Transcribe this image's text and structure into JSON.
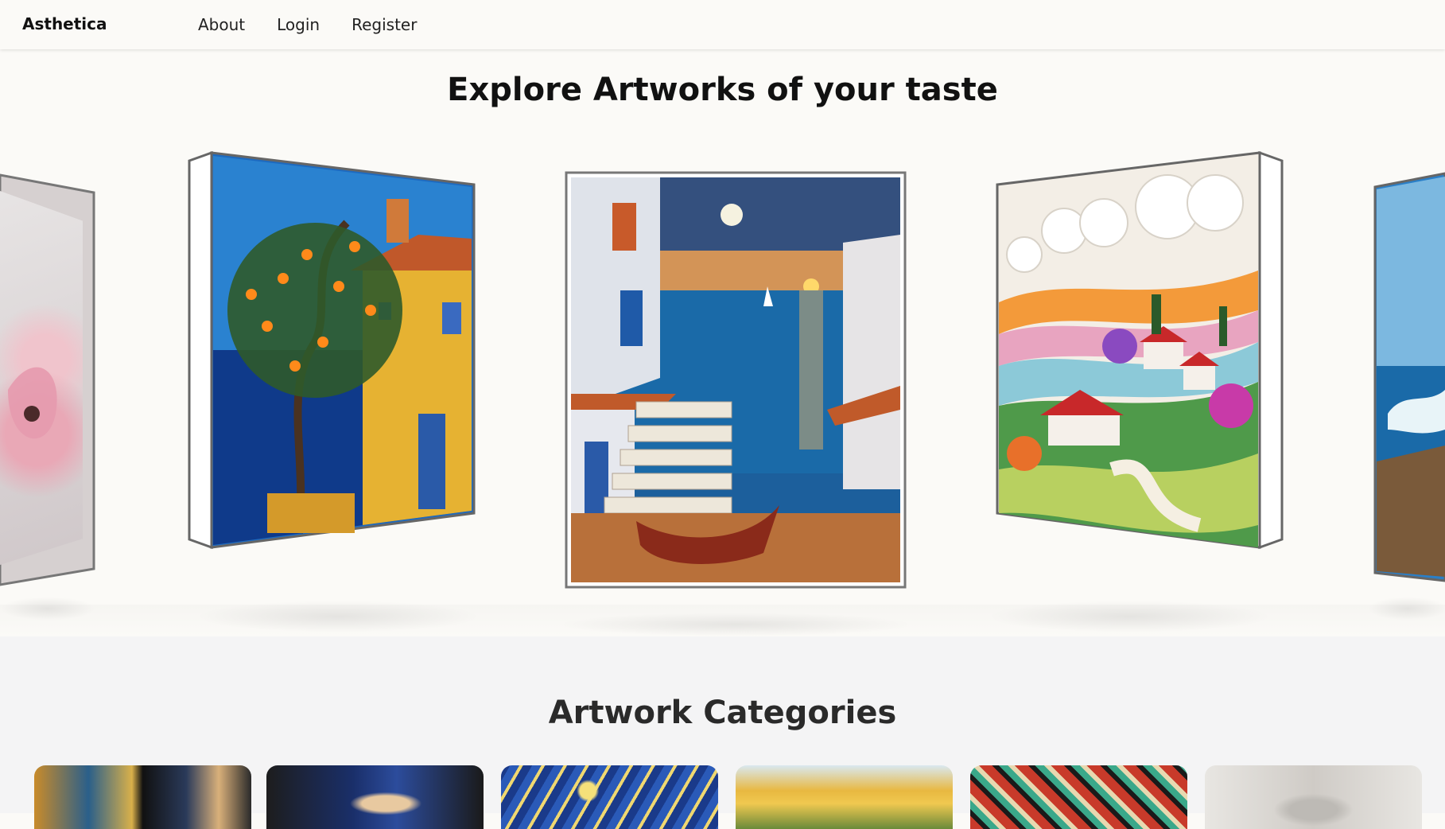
{
  "nav": {
    "brand": "Asthetica",
    "links": [
      "About",
      "Login",
      "Register"
    ]
  },
  "hero": {
    "title": "Explore Artworks of your taste"
  },
  "carousel": {
    "artworks": [
      "pink-flower-painting",
      "orange-tree-house-painting",
      "seaside-stairs-sunset-painting",
      "quilted-countryside-painting",
      "stormy-coast-painting"
    ]
  },
  "categories": {
    "title": "Artwork Categories",
    "cards": [
      "collage-category",
      "portrait-category",
      "starry-night-category",
      "landscape-category",
      "pattern-category",
      "sketch-category"
    ]
  }
}
